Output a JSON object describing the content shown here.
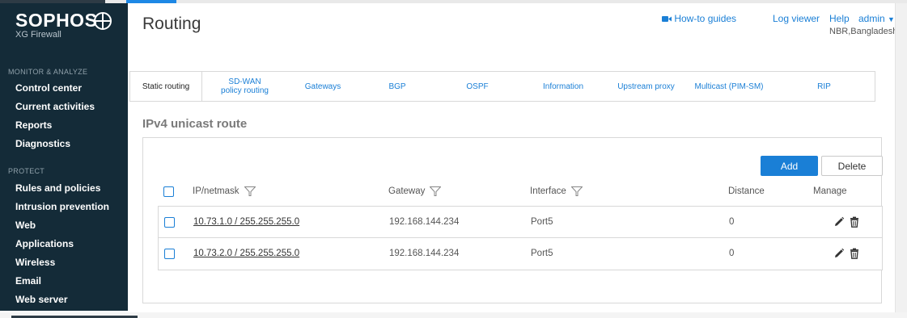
{
  "brand": {
    "name": "SOPHOS",
    "product": "XG Firewall"
  },
  "sidebar": {
    "sections": [
      {
        "label": "MONITOR & ANALYZE",
        "items": [
          "Control center",
          "Current activities",
          "Reports",
          "Diagnostics"
        ]
      },
      {
        "label": "PROTECT",
        "items": [
          "Rules and policies",
          "Intrusion prevention",
          "Web",
          "Applications",
          "Wireless",
          "Email",
          "Web server"
        ]
      }
    ]
  },
  "header": {
    "title": "Routing",
    "links": {
      "howto": "How-to guides",
      "log_viewer": "Log viewer",
      "help": "Help",
      "admin": "admin"
    },
    "admin_location": "NBR,Bangladesh"
  },
  "tabs": [
    {
      "label": "Static routing",
      "active": true
    },
    {
      "label": "SD-WAN policy routing",
      "active": false
    },
    {
      "label": "Gateways",
      "active": false
    },
    {
      "label": "BGP",
      "active": false
    },
    {
      "label": "OSPF",
      "active": false
    },
    {
      "label": "Information",
      "active": false
    },
    {
      "label": "Upstream proxy",
      "active": false
    },
    {
      "label": "Multicast (PIM-SM)",
      "active": false
    },
    {
      "label": "RIP",
      "active": false
    }
  ],
  "section": {
    "title": "IPv4 unicast route"
  },
  "actions": {
    "add": "Add",
    "delete": "Delete"
  },
  "table": {
    "columns": {
      "ip": "IP/netmask",
      "gateway": "Gateway",
      "interface": "Interface",
      "distance": "Distance",
      "manage": "Manage"
    },
    "rows": [
      {
        "ip": "10.73.1.0 / 255.255.255.0",
        "gateway": "192.168.144.234",
        "interface": "Port5",
        "distance": "0"
      },
      {
        "ip": "10.73.2.0 / 255.255.255.0",
        "gateway": "192.168.144.234",
        "interface": "Port5",
        "distance": "0"
      }
    ]
  },
  "colors": {
    "sidebar_bg": "#142b38",
    "accent": "#1a7fd6"
  },
  "icons": [
    "sophos-globe-icon",
    "video-icon",
    "caret-down-icon",
    "filter-icon",
    "edit-pencil-icon",
    "trash-icon"
  ]
}
